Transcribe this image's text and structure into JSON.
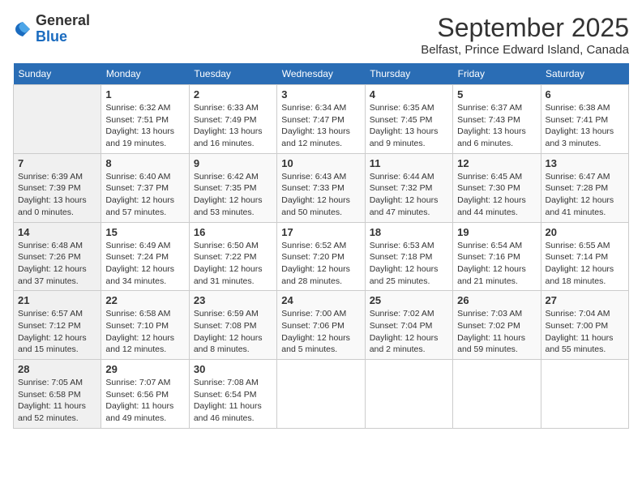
{
  "header": {
    "logo_general": "General",
    "logo_blue": "Blue",
    "month": "September 2025",
    "location": "Belfast, Prince Edward Island, Canada"
  },
  "weekdays": [
    "Sunday",
    "Monday",
    "Tuesday",
    "Wednesday",
    "Thursday",
    "Friday",
    "Saturday"
  ],
  "weeks": [
    [
      {
        "day": "",
        "sunrise": "",
        "sunset": "",
        "daylight": ""
      },
      {
        "day": "1",
        "sunrise": "Sunrise: 6:32 AM",
        "sunset": "Sunset: 7:51 PM",
        "daylight": "Daylight: 13 hours and 19 minutes."
      },
      {
        "day": "2",
        "sunrise": "Sunrise: 6:33 AM",
        "sunset": "Sunset: 7:49 PM",
        "daylight": "Daylight: 13 hours and 16 minutes."
      },
      {
        "day": "3",
        "sunrise": "Sunrise: 6:34 AM",
        "sunset": "Sunset: 7:47 PM",
        "daylight": "Daylight: 13 hours and 12 minutes."
      },
      {
        "day": "4",
        "sunrise": "Sunrise: 6:35 AM",
        "sunset": "Sunset: 7:45 PM",
        "daylight": "Daylight: 13 hours and 9 minutes."
      },
      {
        "day": "5",
        "sunrise": "Sunrise: 6:37 AM",
        "sunset": "Sunset: 7:43 PM",
        "daylight": "Daylight: 13 hours and 6 minutes."
      },
      {
        "day": "6",
        "sunrise": "Sunrise: 6:38 AM",
        "sunset": "Sunset: 7:41 PM",
        "daylight": "Daylight: 13 hours and 3 minutes."
      }
    ],
    [
      {
        "day": "7",
        "sunrise": "Sunrise: 6:39 AM",
        "sunset": "Sunset: 7:39 PM",
        "daylight": "Daylight: 13 hours and 0 minutes."
      },
      {
        "day": "8",
        "sunrise": "Sunrise: 6:40 AM",
        "sunset": "Sunset: 7:37 PM",
        "daylight": "Daylight: 12 hours and 57 minutes."
      },
      {
        "day": "9",
        "sunrise": "Sunrise: 6:42 AM",
        "sunset": "Sunset: 7:35 PM",
        "daylight": "Daylight: 12 hours and 53 minutes."
      },
      {
        "day": "10",
        "sunrise": "Sunrise: 6:43 AM",
        "sunset": "Sunset: 7:33 PM",
        "daylight": "Daylight: 12 hours and 50 minutes."
      },
      {
        "day": "11",
        "sunrise": "Sunrise: 6:44 AM",
        "sunset": "Sunset: 7:32 PM",
        "daylight": "Daylight: 12 hours and 47 minutes."
      },
      {
        "day": "12",
        "sunrise": "Sunrise: 6:45 AM",
        "sunset": "Sunset: 7:30 PM",
        "daylight": "Daylight: 12 hours and 44 minutes."
      },
      {
        "day": "13",
        "sunrise": "Sunrise: 6:47 AM",
        "sunset": "Sunset: 7:28 PM",
        "daylight": "Daylight: 12 hours and 41 minutes."
      }
    ],
    [
      {
        "day": "14",
        "sunrise": "Sunrise: 6:48 AM",
        "sunset": "Sunset: 7:26 PM",
        "daylight": "Daylight: 12 hours and 37 minutes."
      },
      {
        "day": "15",
        "sunrise": "Sunrise: 6:49 AM",
        "sunset": "Sunset: 7:24 PM",
        "daylight": "Daylight: 12 hours and 34 minutes."
      },
      {
        "day": "16",
        "sunrise": "Sunrise: 6:50 AM",
        "sunset": "Sunset: 7:22 PM",
        "daylight": "Daylight: 12 hours and 31 minutes."
      },
      {
        "day": "17",
        "sunrise": "Sunrise: 6:52 AM",
        "sunset": "Sunset: 7:20 PM",
        "daylight": "Daylight: 12 hours and 28 minutes."
      },
      {
        "day": "18",
        "sunrise": "Sunrise: 6:53 AM",
        "sunset": "Sunset: 7:18 PM",
        "daylight": "Daylight: 12 hours and 25 minutes."
      },
      {
        "day": "19",
        "sunrise": "Sunrise: 6:54 AM",
        "sunset": "Sunset: 7:16 PM",
        "daylight": "Daylight: 12 hours and 21 minutes."
      },
      {
        "day": "20",
        "sunrise": "Sunrise: 6:55 AM",
        "sunset": "Sunset: 7:14 PM",
        "daylight": "Daylight: 12 hours and 18 minutes."
      }
    ],
    [
      {
        "day": "21",
        "sunrise": "Sunrise: 6:57 AM",
        "sunset": "Sunset: 7:12 PM",
        "daylight": "Daylight: 12 hours and 15 minutes."
      },
      {
        "day": "22",
        "sunrise": "Sunrise: 6:58 AM",
        "sunset": "Sunset: 7:10 PM",
        "daylight": "Daylight: 12 hours and 12 minutes."
      },
      {
        "day": "23",
        "sunrise": "Sunrise: 6:59 AM",
        "sunset": "Sunset: 7:08 PM",
        "daylight": "Daylight: 12 hours and 8 minutes."
      },
      {
        "day": "24",
        "sunrise": "Sunrise: 7:00 AM",
        "sunset": "Sunset: 7:06 PM",
        "daylight": "Daylight: 12 hours and 5 minutes."
      },
      {
        "day": "25",
        "sunrise": "Sunrise: 7:02 AM",
        "sunset": "Sunset: 7:04 PM",
        "daylight": "Daylight: 12 hours and 2 minutes."
      },
      {
        "day": "26",
        "sunrise": "Sunrise: 7:03 AM",
        "sunset": "Sunset: 7:02 PM",
        "daylight": "Daylight: 11 hours and 59 minutes."
      },
      {
        "day": "27",
        "sunrise": "Sunrise: 7:04 AM",
        "sunset": "Sunset: 7:00 PM",
        "daylight": "Daylight: 11 hours and 55 minutes."
      }
    ],
    [
      {
        "day": "28",
        "sunrise": "Sunrise: 7:05 AM",
        "sunset": "Sunset: 6:58 PM",
        "daylight": "Daylight: 11 hours and 52 minutes."
      },
      {
        "day": "29",
        "sunrise": "Sunrise: 7:07 AM",
        "sunset": "Sunset: 6:56 PM",
        "daylight": "Daylight: 11 hours and 49 minutes."
      },
      {
        "day": "30",
        "sunrise": "Sunrise: 7:08 AM",
        "sunset": "Sunset: 6:54 PM",
        "daylight": "Daylight: 11 hours and 46 minutes."
      },
      {
        "day": "",
        "sunrise": "",
        "sunset": "",
        "daylight": ""
      },
      {
        "day": "",
        "sunrise": "",
        "sunset": "",
        "daylight": ""
      },
      {
        "day": "",
        "sunrise": "",
        "sunset": "",
        "daylight": ""
      },
      {
        "day": "",
        "sunrise": "",
        "sunset": "",
        "daylight": ""
      }
    ]
  ]
}
